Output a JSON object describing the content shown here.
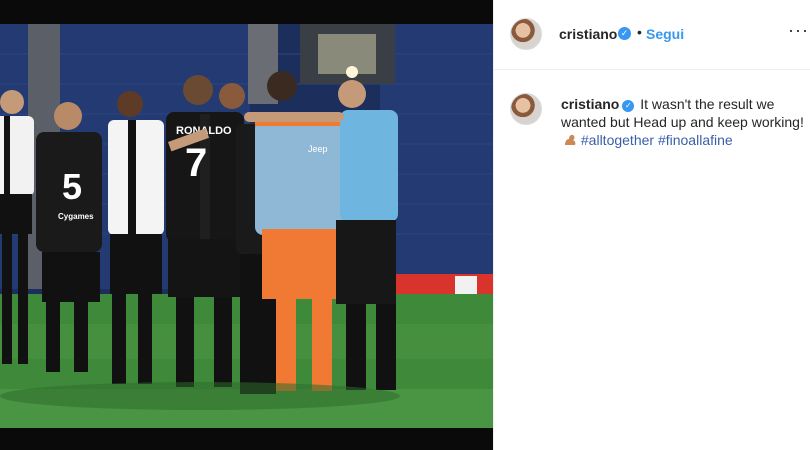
{
  "post": {
    "username": "cristiano",
    "verified_icon": "verified-badge-icon",
    "follow_separator": "•",
    "follow_label": "Segui",
    "more_label": "···"
  },
  "caption": {
    "username": "cristiano",
    "text_main": "It wasn't the result we wanted but Head up and keep working!",
    "emoji": "flexed-biceps-icon",
    "hashtags": [
      "#alltogether",
      "#finoallafine"
    ]
  },
  "photo": {
    "jersey_name": "RONALDO",
    "jersey_number": "7",
    "other_number": "5",
    "sponsor": "Cygames",
    "vest_text": "Jeep"
  },
  "colors": {
    "accent_blue": "#3897f0",
    "hashtag_blue": "#3a5fa8",
    "pitch": "#3f8a3a",
    "stands": "#1b2f5e"
  }
}
